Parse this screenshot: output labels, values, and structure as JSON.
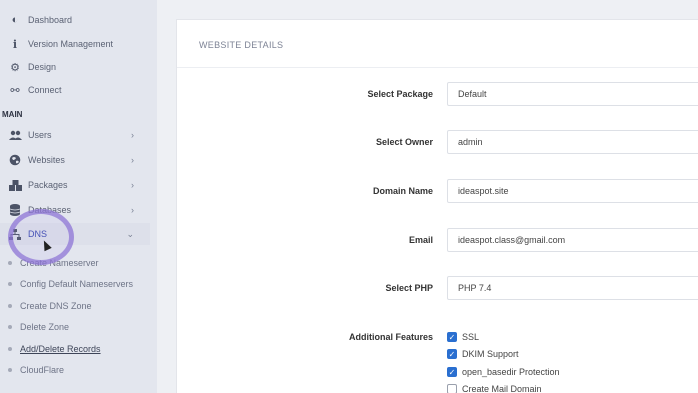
{
  "sidebar": {
    "top_items": [
      {
        "label": "Dashboard",
        "icon": "palette-icon"
      },
      {
        "label": "Version Management",
        "icon": "info-icon"
      },
      {
        "label": "Design",
        "icon": "gear-icon"
      },
      {
        "label": "Connect",
        "icon": "link-icon"
      }
    ],
    "section_label": "MAIN",
    "main_items": [
      {
        "label": "Users",
        "icon": "users-icon"
      },
      {
        "label": "Websites",
        "icon": "globe-icon"
      },
      {
        "label": "Packages",
        "icon": "packages-icon"
      },
      {
        "label": "Databases",
        "icon": "database-icon"
      },
      {
        "label": "DNS",
        "icon": "sitemap-icon"
      }
    ],
    "dns_submenu": [
      "Create Nameserver",
      "Config Default Nameservers",
      "Create DNS Zone",
      "Delete Zone",
      "Add/Delete Records",
      "CloudFlare"
    ]
  },
  "main": {
    "title": "WEBSITE DETAILS",
    "fields": [
      {
        "label": "Select Package",
        "value": "Default"
      },
      {
        "label": "Select Owner",
        "value": "admin"
      },
      {
        "label": "Domain Name",
        "value": "ideaspot.site"
      },
      {
        "label": "Email",
        "value": "ideaspot.class@gmail.com"
      },
      {
        "label": "Select PHP",
        "value": "PHP 7.4"
      }
    ],
    "features_label": "Additional Features",
    "features": [
      {
        "label": "SSL",
        "checked": true
      },
      {
        "label": "DKIM Support",
        "checked": true
      },
      {
        "label": "open_basedir Protection",
        "checked": true
      },
      {
        "label": "Create Mail Domain",
        "checked": false
      }
    ]
  },
  "colors": {
    "sidebar_bg": "#e3e6ee",
    "checkbox_checked": "#2a6fd0",
    "cursor_ring": "#8e75d6"
  }
}
